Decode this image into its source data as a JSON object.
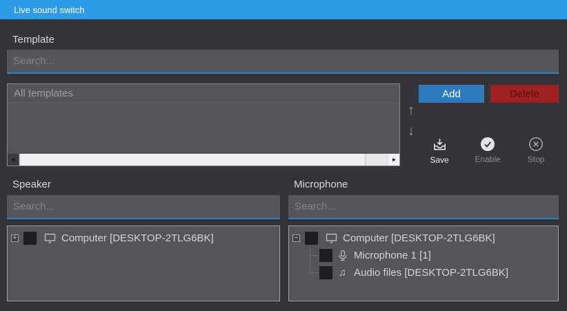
{
  "window": {
    "title": "Live sound switch"
  },
  "template_section": {
    "label": "Template",
    "search": {
      "placeholder": "Search...",
      "value": ""
    },
    "list": {
      "header": "All templates",
      "items": []
    },
    "buttons": {
      "add": "Add",
      "delete": "Delete"
    },
    "reorder": {
      "up_icon": "↑",
      "down_icon": "↓"
    },
    "actions": {
      "save": "Save",
      "enable": "Enable",
      "stop": "Stop"
    }
  },
  "speaker_section": {
    "label": "Speaker",
    "search": {
      "placeholder": "Search...",
      "value": ""
    },
    "tree": [
      {
        "expander": "+",
        "checked": false,
        "icon": "monitor",
        "label": "Computer [DESKTOP-2TLG6BK]"
      }
    ]
  },
  "microphone_section": {
    "label": "Microphone",
    "search": {
      "placeholder": "Search...",
      "value": ""
    },
    "tree": [
      {
        "expander": "−",
        "checked": false,
        "icon": "monitor",
        "label": "Computer [DESKTOP-2TLG6BK]"
      },
      {
        "checked": false,
        "icon": "microphone",
        "label": "Microphone 1 [1]"
      },
      {
        "checked": false,
        "icon": "music-note",
        "label": "Audio files [DESKTOP-2TLG6BK]"
      }
    ]
  },
  "icons": {
    "music_note": "♫",
    "scroll_left": "◄",
    "scroll_right": "►"
  },
  "colors": {
    "titlebar": "#2E9BE8",
    "background": "#343338",
    "panel": "#55545A",
    "accent_underline": "#2D83C8",
    "add_button": "#2C7BBF",
    "delete_button": "#A12121"
  }
}
